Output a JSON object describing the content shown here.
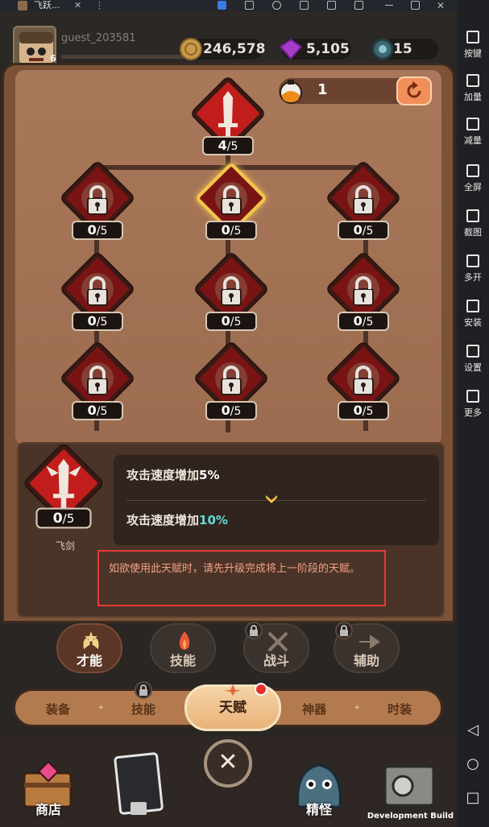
{
  "titlebar": {
    "app_name": "飞跃..."
  },
  "player": {
    "name": "guest_203581",
    "level": "6"
  },
  "resources": {
    "gold": "246,578",
    "gems": "5,105",
    "other": "15"
  },
  "potion": {
    "count": "1"
  },
  "talents": {
    "root": {
      "current": "4",
      "max": "/5"
    },
    "grid": [
      {
        "current": "0",
        "max": "/5",
        "selected": false
      },
      {
        "current": "0",
        "max": "/5",
        "selected": true
      },
      {
        "current": "0",
        "max": "/5",
        "selected": false
      },
      {
        "current": "0",
        "max": "/5",
        "selected": false
      },
      {
        "current": "0",
        "max": "/5",
        "selected": false
      },
      {
        "current": "0",
        "max": "/5",
        "selected": false
      },
      {
        "current": "0",
        "max": "/5",
        "selected": false
      },
      {
        "current": "0",
        "max": "/5",
        "selected": false
      },
      {
        "current": "0",
        "max": "/5",
        "selected": false
      }
    ]
  },
  "detail": {
    "name": "飞剑",
    "current": "0",
    "max": "/5",
    "line1_text": "攻击速度增加",
    "line1_value": "5%",
    "line2_text": "攻击速度增加",
    "line2_value": "10%",
    "warning": "如欲使用此天赋时，请先升级完成将上一阶段的天赋。"
  },
  "tabs": [
    {
      "label": "才能",
      "locked": false,
      "active": true
    },
    {
      "label": "技能",
      "locked": false,
      "active": false
    },
    {
      "label": "战斗",
      "locked": true,
      "active": false
    },
    {
      "label": "辅助",
      "locked": true,
      "active": false
    }
  ],
  "categories": [
    "装备",
    "技能",
    "天赋",
    "神器",
    "时装"
  ],
  "active_category": "天赋",
  "bottom_nav": {
    "shop": "商店",
    "monster": "精怪",
    "dev_build": "Development Build"
  },
  "sidebar": {
    "items": [
      "按键",
      "加量",
      "减量",
      "全屏",
      "截图",
      "多开",
      "安装",
      "设置",
      "更多"
    ]
  },
  "colors": {
    "accent_red": "#c21d1d",
    "gold": "#f4c64a",
    "cyan": "#5ee0d4",
    "warning_border": "#e53a3a"
  }
}
